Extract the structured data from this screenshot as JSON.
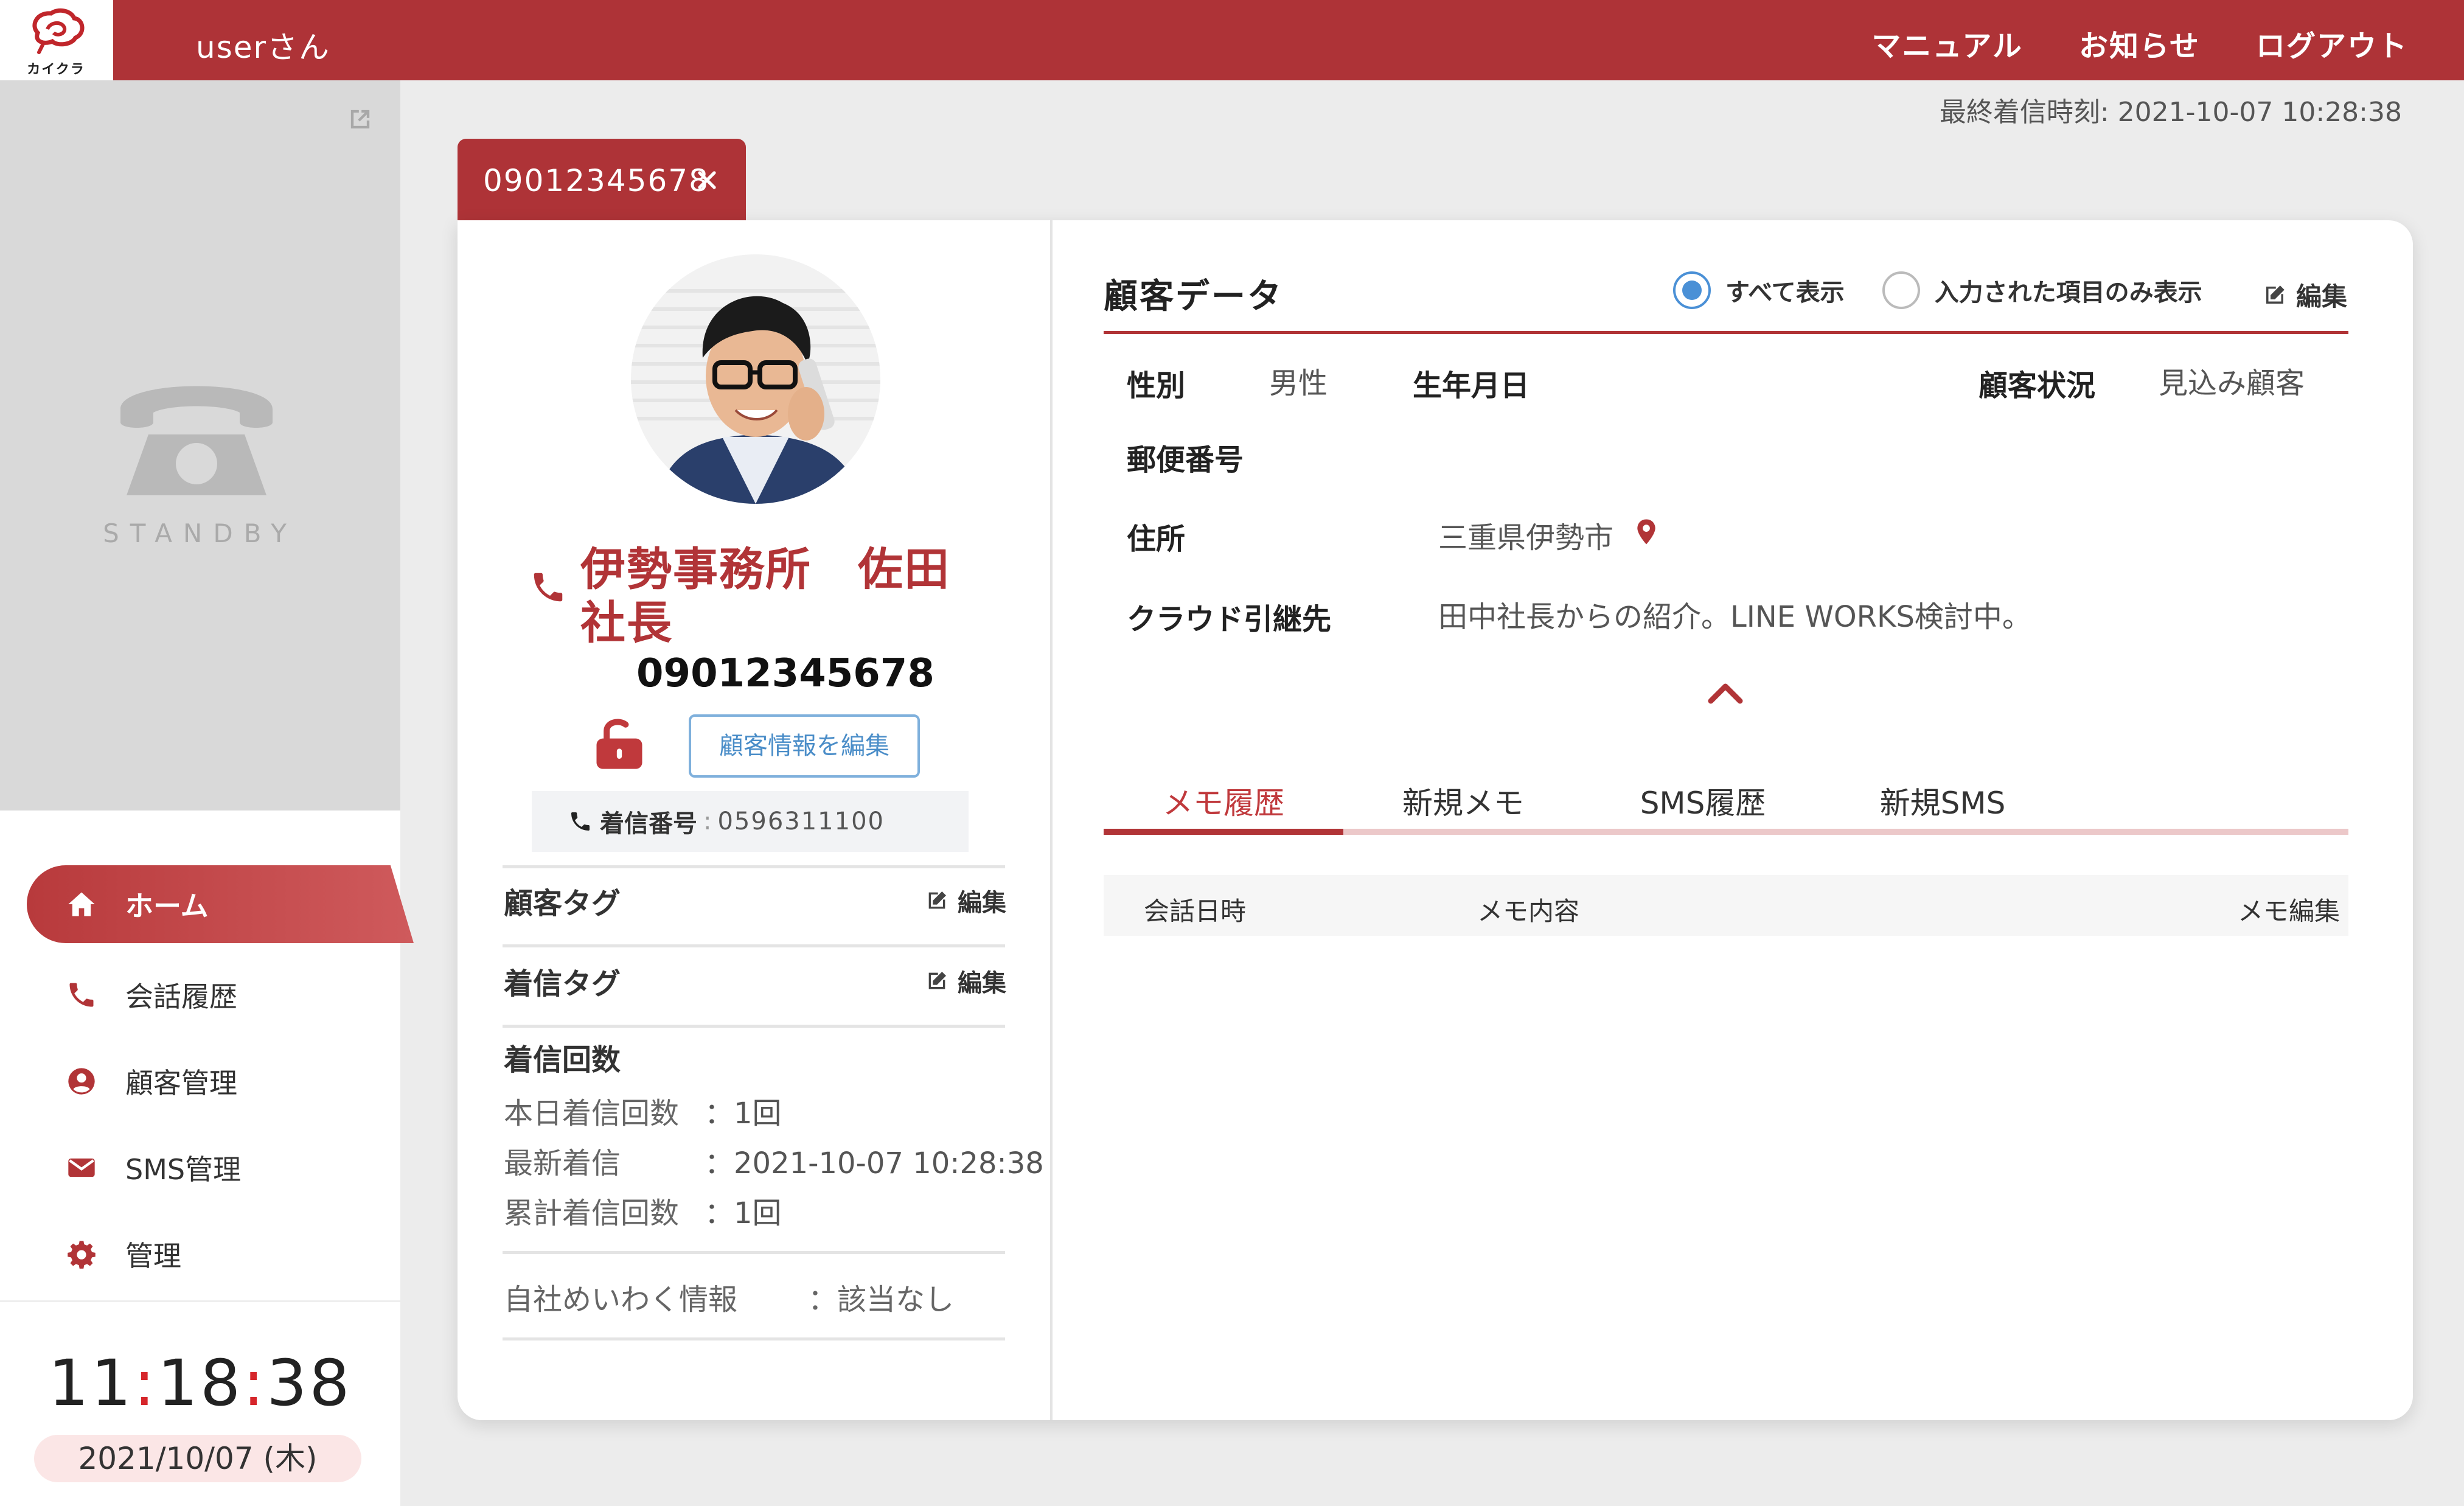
{
  "brand": {
    "logo_text": "カイクラ"
  },
  "header": {
    "user_label": "userさん",
    "nav": [
      "マニュアル",
      "お知らせ",
      "ログアウト"
    ],
    "last_call": "最終着信時刻: 2021-10-07 10:28:38"
  },
  "sidebar": {
    "standby_label": "STANDBY",
    "menu": [
      {
        "label": "ホーム",
        "icon": "home-icon",
        "active": true
      },
      {
        "label": "会話履歴",
        "icon": "phone-icon"
      },
      {
        "label": "顧客管理",
        "icon": "user-circle-icon"
      },
      {
        "label": "SMS管理",
        "icon": "mail-icon"
      },
      {
        "label": "管理",
        "icon": "gear-icon"
      }
    ],
    "clock": {
      "hh": "11",
      "mm": "18",
      "ss": "38"
    },
    "date": "2021/10/07 (木)"
  },
  "tab": {
    "label": "09012345678"
  },
  "profile": {
    "name": "伊勢事務所　佐田社長",
    "number": "09012345678",
    "edit_button": "顧客情報を編集",
    "incoming_label": "着信番号",
    "incoming_sep": ":",
    "incoming_value": "0596311100",
    "customer_tag_label": "顧客タグ",
    "call_tag_label": "着信タグ",
    "edit_label": "編集",
    "count_title": "着信回数",
    "counts": [
      {
        "label": "本日着信回数",
        "value": "：1回"
      },
      {
        "label": "最新着信",
        "value": "：2021-10-07 10:28:38"
      },
      {
        "label": "累計着信回数",
        "value": "：1回"
      }
    ],
    "meiwaku_label": "自社めいわく情報",
    "meiwaku_value": "：該当なし"
  },
  "customer_data": {
    "title": "顧客データ",
    "radio_all": "すべて表示",
    "radio_filled": "入力された項目のみ表示",
    "edit_label": "編集",
    "gender_label": "性別",
    "gender_value": "男性",
    "birthday_label": "生年月日",
    "status_label": "顧客状況",
    "status_value": "見込み顧客",
    "postal_label": "郵便番号",
    "address_label": "住所",
    "address_value": "三重県伊勢市",
    "cloud_label": "クラウド引継先",
    "cloud_value": "田中社長からの紹介。LINE WORKS検討中。"
  },
  "memo": {
    "tabs": [
      "メモ履歴",
      "新規メモ",
      "SMS履歴",
      "新規SMS"
    ],
    "active_tab": 0,
    "columns": [
      "会話日時",
      "メモ内容",
      "メモ編集"
    ]
  },
  "colors": {
    "brand": "#ae3337",
    "accent_blue": "#4a90d6",
    "clock_colon": "#d6262b"
  }
}
